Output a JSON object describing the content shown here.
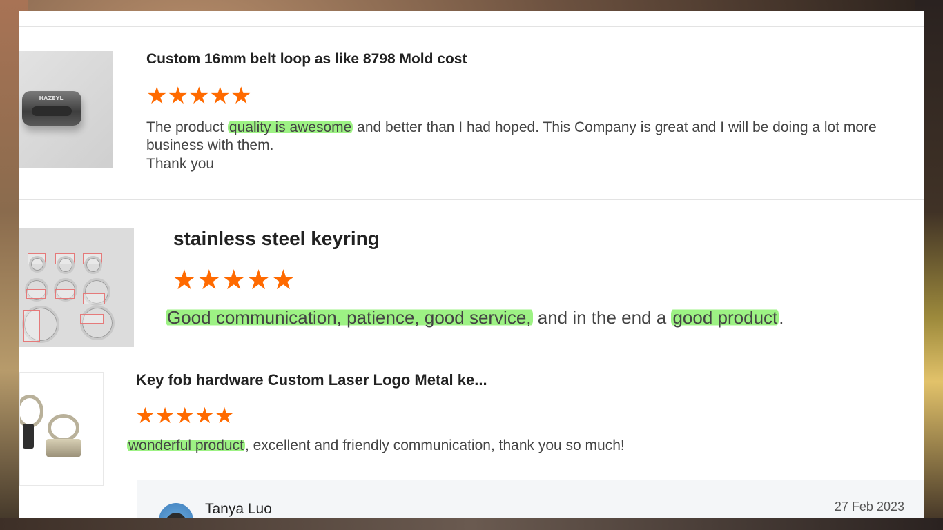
{
  "colors": {
    "star": "#ff6a00",
    "highlight": "#8cf06e",
    "text": "#444444",
    "title": "#222222"
  },
  "reviews": [
    {
      "product": "Custom 16mm belt loop as like 8798 Mold cost",
      "rating": 5,
      "image_icon": "belt-loop-image",
      "image_text": "HAZEYL",
      "text": {
        "p1": "The product ",
        "h1": "quality is awesome",
        "p2": " and better than I had hoped. This Company is great and I will be doing a lot more business with them.",
        "p3": "Thank you"
      }
    },
    {
      "product": "stainless steel keyring",
      "rating": 5,
      "image_icon": "keyrings-image",
      "text": {
        "h1": "Good communication, patience, good service,",
        "p1": " and in the end a ",
        "h2": "good product",
        "p2": "."
      }
    },
    {
      "product": "Key fob hardware Custom Laser Logo Metal ke...",
      "rating": 5,
      "image_icon": "key-fob-image",
      "text": {
        "h1": "wonderful product",
        "p1": ", excellent and friendly communication, thank you so much!"
      }
    }
  ],
  "comment": {
    "author": "Tanya Luo",
    "date": "27 Feb 2023",
    "avatar_icon": "avatar-icon"
  },
  "star_glyph": "★"
}
